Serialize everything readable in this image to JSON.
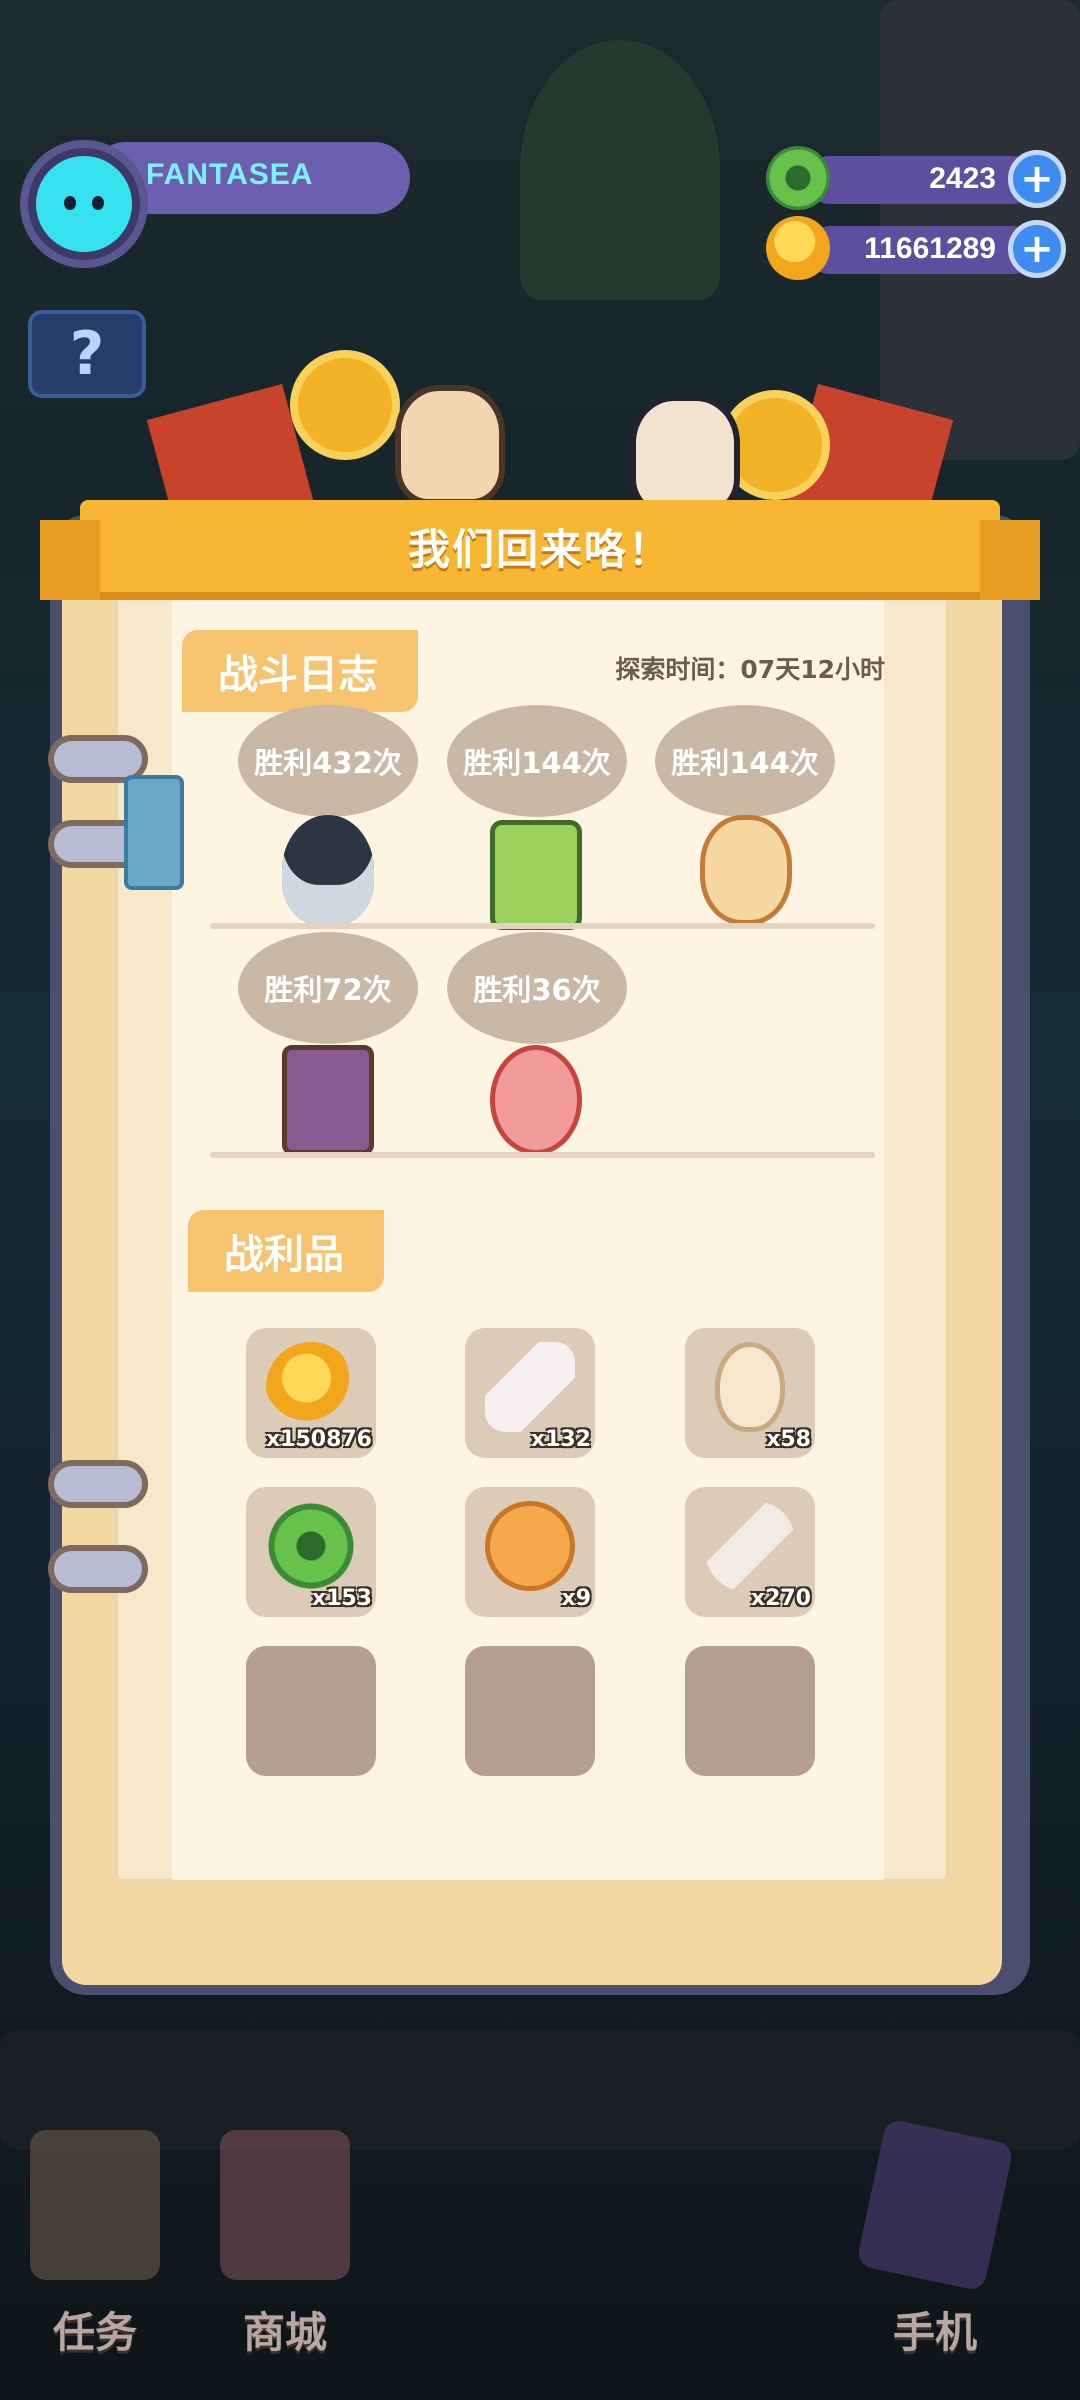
{
  "player": {
    "name": "FANTASEA"
  },
  "currencies": [
    {
      "id": "donut",
      "value": "2423",
      "icon": "green-donut-icon",
      "color": "#5fb84a"
    },
    {
      "id": "coin",
      "value": "11661289",
      "icon": "planet-coin-icon",
      "color": "#f7b92b"
    }
  ],
  "dialog": {
    "title": "我们回来咯！",
    "battle_log_label": "战斗日志",
    "explore_time": "探索时间：07天12小时",
    "battles": [
      {
        "label": "胜利432次",
        "creature": "penguin-bird"
      },
      {
        "label": "胜利144次",
        "creature": "green-scroll-creature"
      },
      {
        "label": "胜利144次",
        "creature": "spotted-bread-creature"
      },
      {
        "label": "胜利72次",
        "creature": "purple-cart-creature"
      },
      {
        "label": "胜利36次",
        "creature": "pink-pig-creature"
      }
    ],
    "loot_label": "战利品",
    "loot": [
      {
        "icon": "planet-coin-icon",
        "count": "x150876"
      },
      {
        "icon": "bone-icon",
        "count": "x132"
      },
      {
        "icon": "seed-icon",
        "count": "x58"
      },
      {
        "icon": "green-donut-icon",
        "count": "x153"
      },
      {
        "icon": "mooncake-icon",
        "count": "x9"
      },
      {
        "icon": "feather-icon",
        "count": "x270"
      },
      {
        "icon": "",
        "count": ""
      },
      {
        "icon": "",
        "count": ""
      },
      {
        "icon": "",
        "count": ""
      }
    ]
  },
  "nav": {
    "tasks": "任务",
    "shop": "商城",
    "phone": "手机"
  },
  "colors": {
    "ribbon": "#f7b733",
    "paper": "#fdf4e1",
    "bubble": "#c9b8a6",
    "book_frame": "#4b4f6e"
  }
}
